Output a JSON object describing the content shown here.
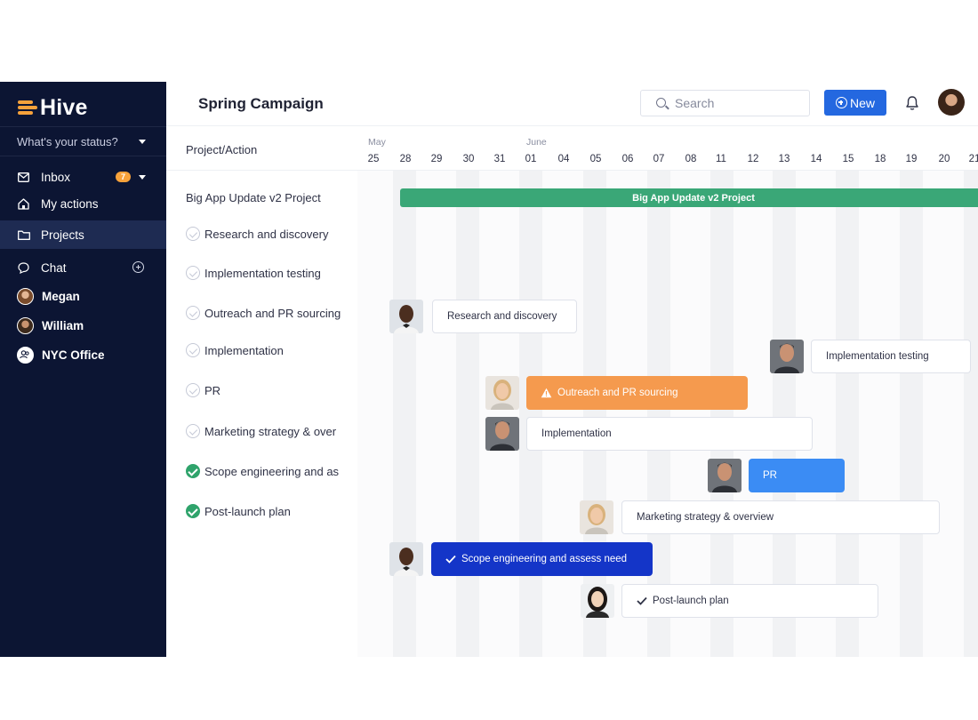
{
  "app": {
    "name": "Hive"
  },
  "sidebar": {
    "status_placeholder": "What's your status?",
    "items": [
      {
        "label": "Inbox",
        "icon": "mail-icon",
        "badge": "7"
      },
      {
        "label": "My actions",
        "icon": "home-icon"
      },
      {
        "label": "Projects",
        "icon": "folder-icon",
        "active": true
      },
      {
        "label": "Chat",
        "icon": "chat-icon"
      }
    ],
    "people": [
      {
        "label": "Megan"
      },
      {
        "label": "William"
      },
      {
        "label": "NYC Office",
        "icon": "group-icon"
      }
    ]
  },
  "header": {
    "title": "Spring Campaign",
    "search_placeholder": "Search",
    "new_label": "New"
  },
  "list": {
    "column_header": "Project/Action",
    "project": "Big App Update v2 Project",
    "tasks": [
      {
        "label": "Research and discovery",
        "done": false
      },
      {
        "label": "Implementation testing",
        "done": false
      },
      {
        "label": "Outreach and PR sourcing",
        "done": false
      },
      {
        "label": "Implementation",
        "done": false
      },
      {
        "label": "PR",
        "done": false
      },
      {
        "label": "Marketing strategy & over",
        "done": false
      },
      {
        "label": "Scope engineering and as",
        "done": true
      },
      {
        "label": "Post-launch plan",
        "done": true
      }
    ]
  },
  "timeline": {
    "months": [
      "May",
      "June"
    ],
    "days": [
      "25",
      "28",
      "29",
      "30",
      "31",
      "01",
      "04",
      "05",
      "06",
      "07",
      "08",
      "11",
      "12",
      "13",
      "14",
      "15",
      "18",
      "19",
      "20",
      "21"
    ]
  },
  "gantt": {
    "project_bar": "Big App Update v2 Project",
    "bars": [
      {
        "label": "Research and discovery",
        "style": "white"
      },
      {
        "label": "Implementation testing",
        "style": "white"
      },
      {
        "label": "Outreach and PR sourcing",
        "style": "orange",
        "icon": "warning-icon"
      },
      {
        "label": "Implementation",
        "style": "white"
      },
      {
        "label": "PR",
        "style": "blue"
      },
      {
        "label": "Marketing strategy & overview",
        "style": "white"
      },
      {
        "label": "Scope engineering and assess need",
        "style": "navy",
        "icon": "check-icon"
      },
      {
        "label": "Post-launch plan",
        "style": "white",
        "icon": "check-icon"
      }
    ]
  },
  "colors": {
    "sidebar_bg": "#0c1533",
    "accent": "#2468e0",
    "logo": "#f7a23b",
    "project_bar": "#3aa777",
    "orange": "#f59a4e",
    "blue": "#3b8cf4",
    "navy": "#1435c8",
    "done": "#2fa36b"
  }
}
